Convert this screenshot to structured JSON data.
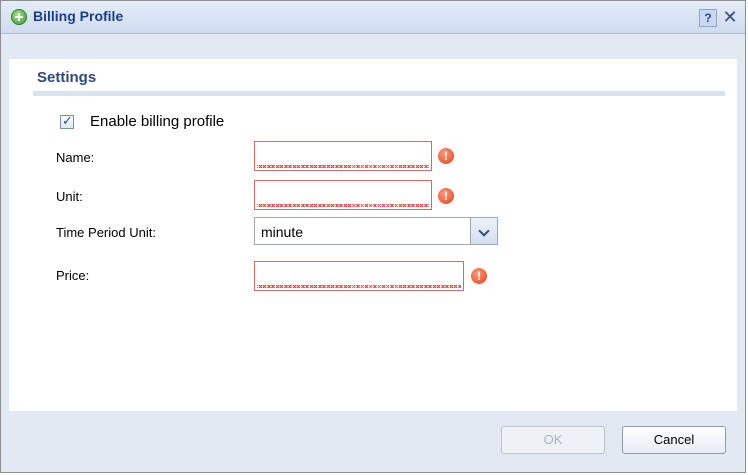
{
  "dialog": {
    "title": "Billing Profile",
    "help_label": "?",
    "close_label": "✕"
  },
  "section": {
    "title": "Settings"
  },
  "enable": {
    "label": "Enable billing profile",
    "checked": true
  },
  "fields": {
    "name": {
      "label": "Name:",
      "value": ""
    },
    "unit": {
      "label": "Unit:",
      "value": ""
    },
    "time_period_unit": {
      "label": "Time Period Unit:",
      "value": "minute"
    },
    "price": {
      "label": "Price:",
      "value": ""
    }
  },
  "buttons": {
    "ok": "OK",
    "cancel": "Cancel"
  }
}
